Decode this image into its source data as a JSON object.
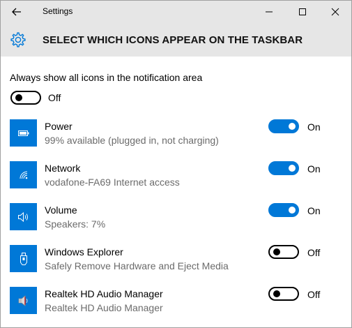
{
  "window": {
    "title": "Settings"
  },
  "header": {
    "title": "SELECT WHICH ICONS APPEAR ON THE TASKBAR"
  },
  "always_show": {
    "label": "Always show all icons in the notification area",
    "state": "off",
    "state_label": "Off"
  },
  "accent_color": "#0078d7",
  "items": [
    {
      "icon": "battery-icon",
      "title": "Power",
      "subtitle": "99% available (plugged in, not charging)",
      "state": "on",
      "state_label": "On"
    },
    {
      "icon": "network-icon",
      "title": "Network",
      "subtitle": "vodafone-FA69 Internet access",
      "state": "on",
      "state_label": "On"
    },
    {
      "icon": "speaker-icon",
      "title": "Volume",
      "subtitle": "Speakers: 7%",
      "state": "on",
      "state_label": "On"
    },
    {
      "icon": "usb-drive-icon",
      "title": "Windows Explorer",
      "subtitle": "Safely Remove Hardware and Eject Media",
      "state": "off",
      "state_label": "Off"
    },
    {
      "icon": "realtek-speaker-icon",
      "title": "Realtek HD Audio Manager",
      "subtitle": "Realtek HD Audio Manager",
      "state": "off",
      "state_label": "Off"
    }
  ]
}
